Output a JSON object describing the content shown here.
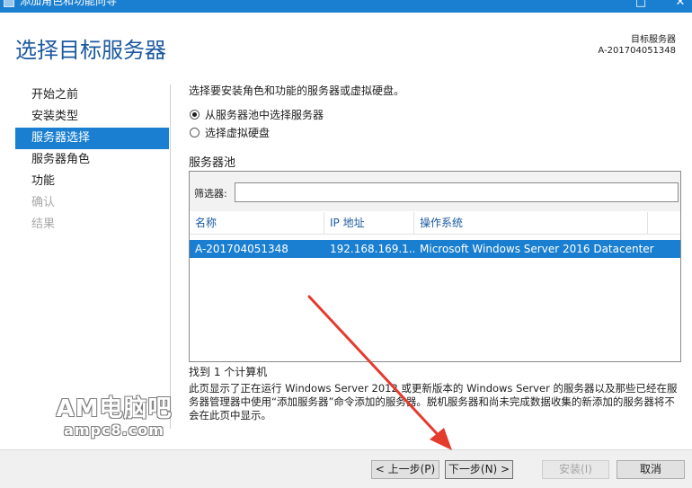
{
  "window": {
    "title": "添加角色和功能向导",
    "restore_glyph": "□",
    "close_glyph": "✕"
  },
  "header": {
    "title": "选择目标服务器",
    "dest_label": "目标服务器",
    "dest_value": "A-201704051348"
  },
  "nav": {
    "items": [
      {
        "label": "开始之前",
        "state": "normal"
      },
      {
        "label": "安装类型",
        "state": "normal"
      },
      {
        "label": "服务器选择",
        "state": "active"
      },
      {
        "label": "服务器角色",
        "state": "normal"
      },
      {
        "label": "功能",
        "state": "normal"
      },
      {
        "label": "确认",
        "state": "disabled"
      },
      {
        "label": "结果",
        "state": "disabled"
      }
    ]
  },
  "main": {
    "instruction": "选择要安装角色和功能的服务器或虚拟硬盘。",
    "radio_pool": "从服务器池中选择服务器",
    "radio_vhd": "选择虚拟硬盘",
    "pool_label": "服务器池",
    "filter_label": "筛选器:",
    "filter_value": "",
    "columns": [
      "名称",
      "IP 地址",
      "操作系统"
    ],
    "rows": [
      {
        "name": "A-201704051348",
        "ip": "192.168.169.1...",
        "os": "Microsoft Windows Server 2016 Datacenter"
      }
    ],
    "found": "找到 1 个计算机",
    "description": "此页显示了正在运行 Windows Server 2012 或更新版本的 Windows Server 的服务器以及那些已经在服务器管理器中使用“添加服务器”命令添加的服务器。脱机服务器和尚未完成数据收集的新添加的服务器将不会在此页中显示。"
  },
  "footer": {
    "prev": "< 上一步(P)",
    "next": "下一步(N) >",
    "install": "安装(I)",
    "cancel": "取消"
  },
  "watermark": {
    "line1": "AM电脑吧",
    "line2": "ampc8.com"
  },
  "colors": {
    "accent": "#1a7fd0",
    "title_text": "#1b5aa0",
    "annotation_arrow": "#e53a2e"
  }
}
